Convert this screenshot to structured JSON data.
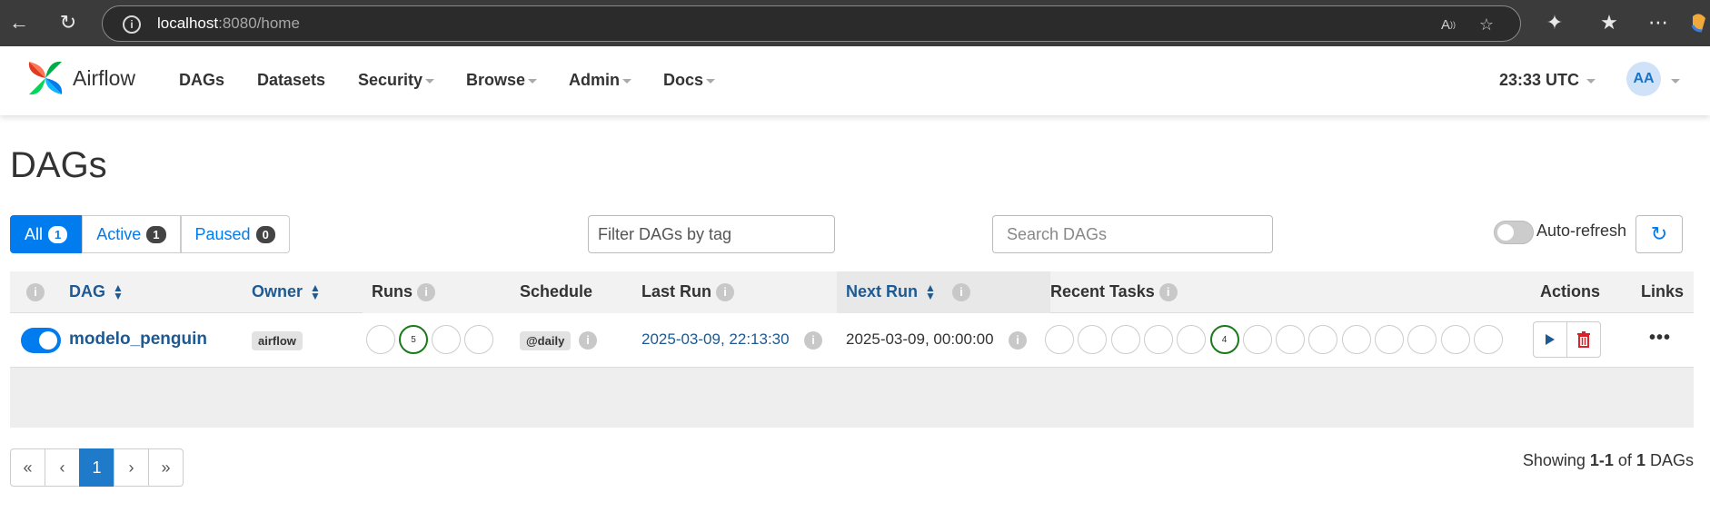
{
  "browser": {
    "url_host": "localhost",
    "url_rest": ":8080/home"
  },
  "navbar": {
    "brand": "Airflow",
    "items": [
      {
        "label": "DAGs",
        "dropdown": false
      },
      {
        "label": "Datasets",
        "dropdown": false
      },
      {
        "label": "Security",
        "dropdown": true
      },
      {
        "label": "Browse",
        "dropdown": true
      },
      {
        "label": "Admin",
        "dropdown": true
      },
      {
        "label": "Docs",
        "dropdown": true
      }
    ],
    "time": "23:33 UTC",
    "avatar_initials": "AA"
  },
  "page": {
    "title": "DAGs"
  },
  "filters": {
    "all_label": "All",
    "all_count": "1",
    "active_label": "Active",
    "active_count": "1",
    "paused_label": "Paused",
    "paused_count": "0",
    "tag_placeholder": "Filter DAGs by tag",
    "search_placeholder": "Search DAGs",
    "auto_refresh_label": "Auto-refresh"
  },
  "table": {
    "headers": {
      "dag": "DAG",
      "owner": "Owner",
      "runs": "Runs",
      "schedule": "Schedule",
      "last_run": "Last Run",
      "next_run": "Next Run",
      "recent_tasks": "Recent Tasks",
      "actions": "Actions",
      "links": "Links"
    },
    "rows": [
      {
        "dag_id": "modelo_penguin",
        "paused": false,
        "owner": "airflow",
        "runs": [
          "",
          "5",
          "",
          ""
        ],
        "schedule": "@daily",
        "last_run": "2025-03-09, 22:13:30",
        "next_run": "2025-03-09, 00:00:00",
        "recent_tasks": [
          "",
          "",
          "",
          "",
          "",
          "4",
          "",
          "",
          "",
          "",
          "",
          "",
          "",
          ""
        ]
      }
    ]
  },
  "pagination": {
    "first": "«",
    "prev": "‹",
    "current": "1",
    "next": "›",
    "last": "»",
    "showing_prefix": "Showing",
    "showing_range": "1-1",
    "showing_of": "of",
    "showing_total": "1",
    "showing_suffix": "DAGs"
  },
  "colors": {
    "primary": "#017cee",
    "success_ring": "#1a7a1a",
    "delete": "#d9232b",
    "link": "#1d5a93"
  }
}
